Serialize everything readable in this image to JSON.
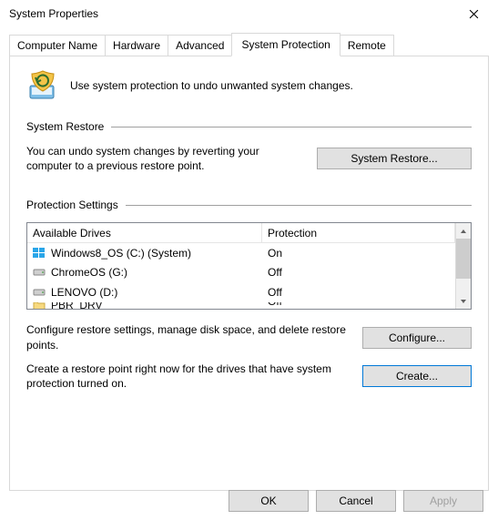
{
  "window": {
    "title": "System Properties"
  },
  "tabs": [
    {
      "label": "Computer Name"
    },
    {
      "label": "Hardware"
    },
    {
      "label": "Advanced"
    },
    {
      "label": "System Protection",
      "active": true
    },
    {
      "label": "Remote"
    }
  ],
  "intro": "Use system protection to undo unwanted system changes.",
  "restore": {
    "heading": "System Restore",
    "text": "You can undo system changes by reverting your computer to a previous restore point.",
    "button": "System Restore..."
  },
  "protection": {
    "heading": "Protection Settings",
    "headers": {
      "drive": "Available Drives",
      "protection": "Protection"
    },
    "drives": [
      {
        "name": "Windows8_OS (C:) (System)",
        "status": "On",
        "icon": "windows"
      },
      {
        "name": "ChromeOS (G:)",
        "status": "Off",
        "icon": "hdd"
      },
      {
        "name": "LENOVO (D:)",
        "status": "Off",
        "icon": "hdd"
      },
      {
        "name": "PBR_DRV",
        "status": "Off",
        "icon": "folder"
      }
    ],
    "configure": {
      "text": "Configure restore settings, manage disk space, and delete restore points.",
      "button": "Configure..."
    },
    "create": {
      "text": "Create a restore point right now for the drives that have system protection turned on.",
      "button": "Create..."
    }
  },
  "footer": {
    "ok": "OK",
    "cancel": "Cancel",
    "apply": "Apply"
  }
}
